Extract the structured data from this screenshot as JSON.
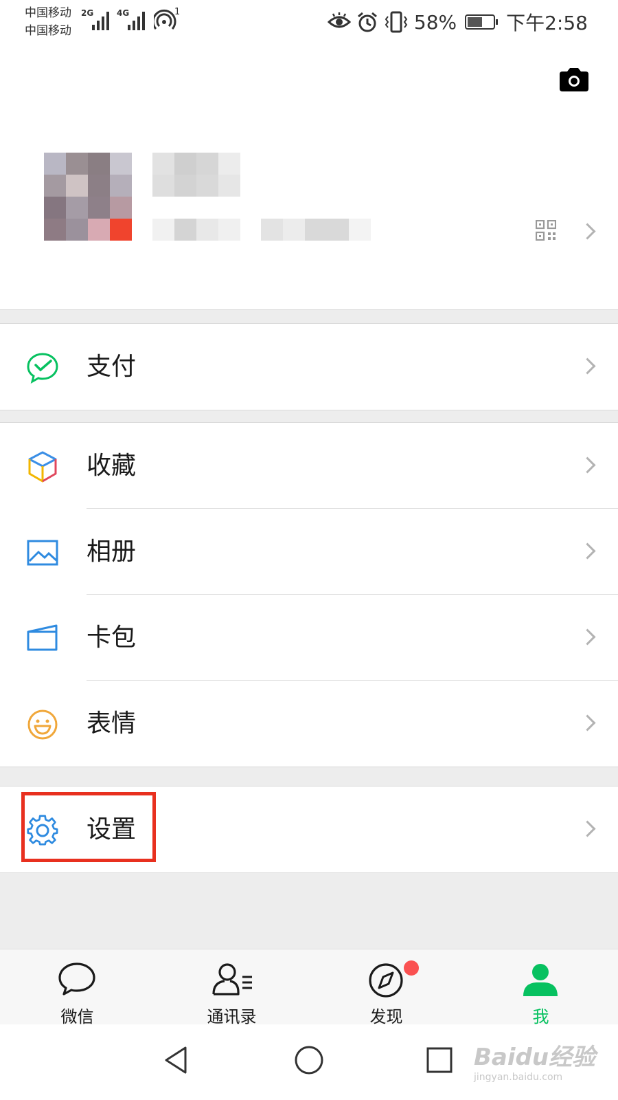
{
  "status_bar": {
    "carrier_1": "中国移动",
    "carrier_2": "中国移动",
    "network_1": "2G",
    "network_2": "4G",
    "hotspot_count": "1",
    "battery": "58%",
    "time": "下午2:58"
  },
  "menu": {
    "pay": "支付",
    "favorites": "收藏",
    "album": "相册",
    "cards": "卡包",
    "stickers": "表情",
    "settings": "设置"
  },
  "tabs": [
    {
      "label": "微信",
      "icon": "chat-icon"
    },
    {
      "label": "通讯录",
      "icon": "contacts-icon"
    },
    {
      "label": "发现",
      "icon": "discover-icon"
    },
    {
      "label": "我",
      "icon": "me-icon",
      "active": true
    }
  ],
  "watermark": {
    "brand": "Baidu经验",
    "url": "jingyan.baidu.com"
  },
  "colors": {
    "accent_green": "#07c160",
    "highlight_red": "#e8301f",
    "badge_red": "#fa5151"
  },
  "battery_level": 0.58
}
